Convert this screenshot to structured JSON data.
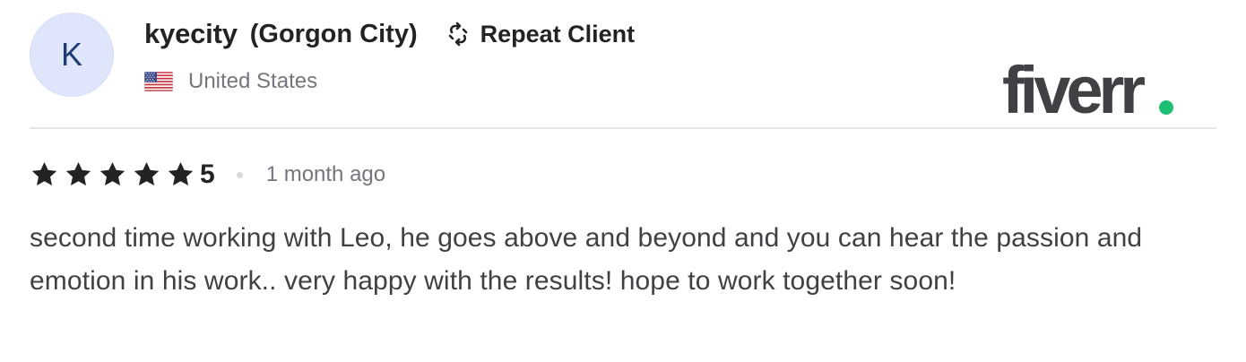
{
  "reviewer": {
    "avatar_letter": "K",
    "username": "kyecity",
    "display_name": "(Gorgon City)",
    "badge": "Repeat Client",
    "country": "United States"
  },
  "brand": {
    "logo_text": "fiverr",
    "logo_color": "#404145",
    "dot_color": "#1dbf73"
  },
  "review": {
    "rating": "5",
    "stars": 5,
    "time_ago": "1 month ago",
    "text": "second time working with Leo, he goes above and beyond and you can hear the passion and emotion in his work.. very happy with the results! hope to work together soon!"
  },
  "colors": {
    "star": "#222325",
    "avatar_bg": "#dfe6fb",
    "avatar_text": "#1f3b73",
    "muted_text": "#74767e"
  },
  "icons": {
    "repeat": "repeat-arrows-icon",
    "flag": "us-flag-icon",
    "star": "star-icon"
  }
}
